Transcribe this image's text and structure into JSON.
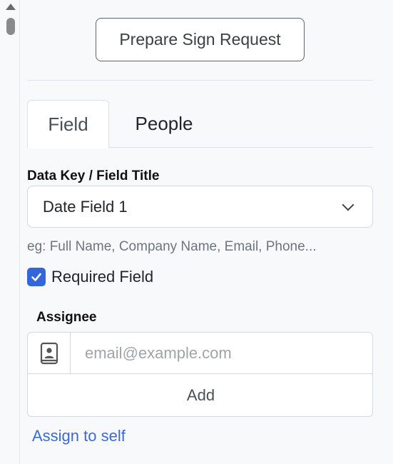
{
  "prepare_button": "Prepare Sign Request",
  "tabs": [
    {
      "label": "Field",
      "active": true
    },
    {
      "label": "People",
      "active": false
    }
  ],
  "data_key": {
    "label": "Data Key / Field Title",
    "selected_value": "Date Field 1",
    "hint": "eg: Full Name, Company Name, Email, Phone..."
  },
  "required_field": {
    "label": "Required Field",
    "checked": true
  },
  "assignee": {
    "label": "Assignee",
    "email_placeholder": "email@example.com",
    "email_value": "",
    "add_label": "Add",
    "assign_self_label": "Assign to self"
  },
  "colors": {
    "accent": "#3366dd",
    "link": "#3b6ad6"
  }
}
